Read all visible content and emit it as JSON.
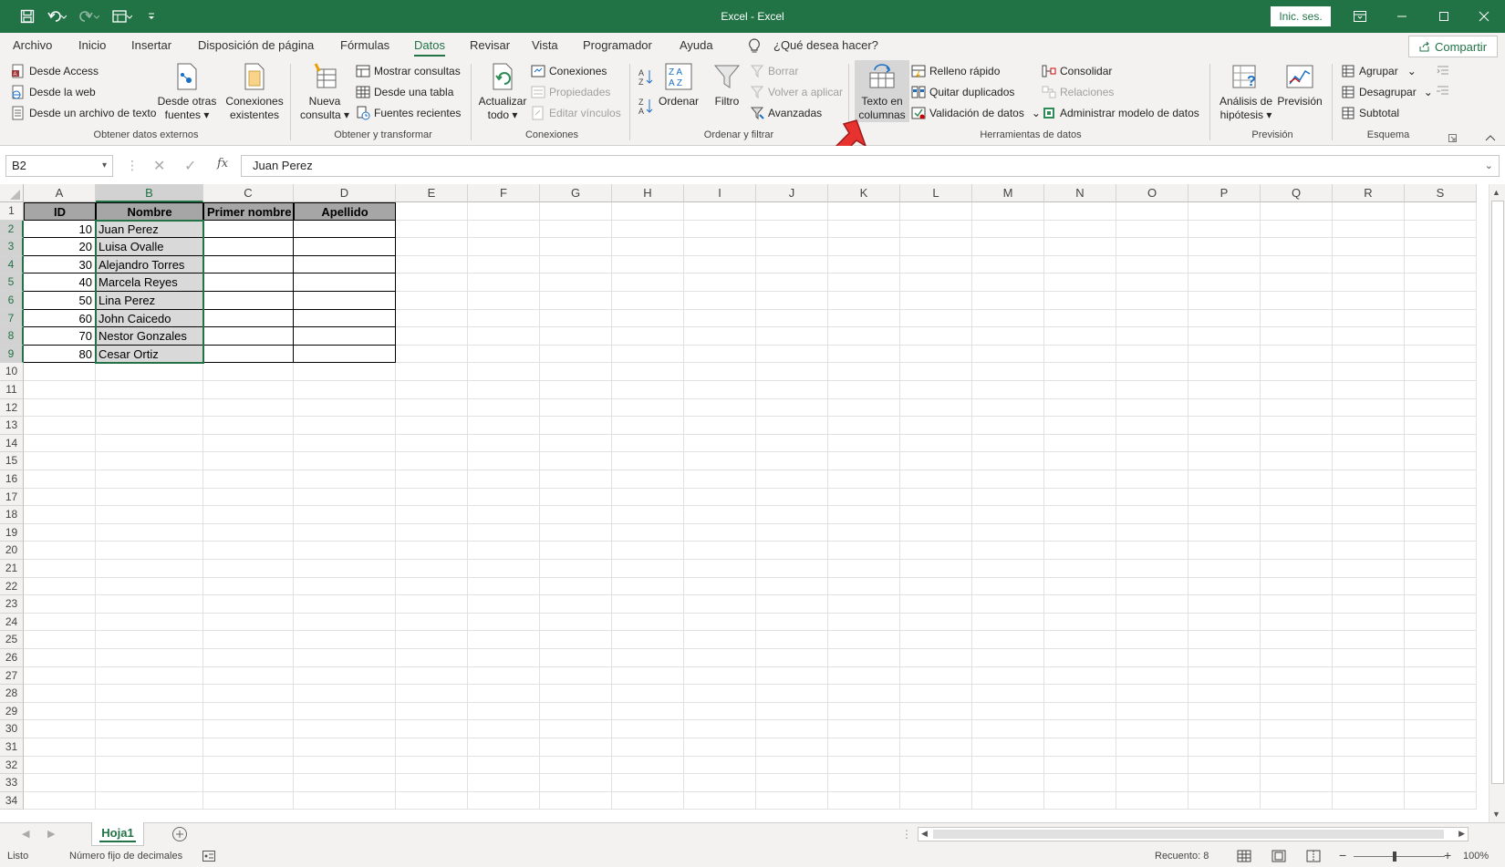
{
  "window": {
    "title": "Excel - Excel",
    "signin_label": "Inic. ses.",
    "accent_color": "#217346"
  },
  "qat": {
    "icons": [
      "save-icon",
      "undo-icon",
      "redo-icon",
      "form-icon",
      "customize-icon"
    ]
  },
  "tabs": [
    {
      "label": "Archivo"
    },
    {
      "label": "Inicio"
    },
    {
      "label": "Insertar"
    },
    {
      "label": "Disposición de página"
    },
    {
      "label": "Fórmulas"
    },
    {
      "label": "Datos"
    },
    {
      "label": "Revisar"
    },
    {
      "label": "Vista"
    },
    {
      "label": "Programador"
    },
    {
      "label": "Ayuda"
    }
  ],
  "active_tab": "Datos",
  "tell_me": "¿Qué desea hacer?",
  "share_label": "Compartir",
  "ribbon": {
    "obtener": {
      "label": "Obtener datos externos",
      "desde_access": "Desde Access",
      "desde_web": "Desde la web",
      "desde_texto": "Desde un archivo de texto",
      "otras_fuentes_1": "Desde otras",
      "otras_fuentes_2": "fuentes",
      "conexiones_existentes_1": "Conexiones",
      "conexiones_existentes_2": "existentes"
    },
    "transformar": {
      "label": "Obtener y transformar",
      "nueva_1": "Nueva",
      "nueva_2": "consulta",
      "mostrar_consultas": "Mostrar consultas",
      "desde_tabla": "Desde una tabla",
      "fuentes_recientes": "Fuentes recientes"
    },
    "conexiones": {
      "label": "Conexiones",
      "actualizar_1": "Actualizar",
      "actualizar_2": "todo",
      "conexiones": "Conexiones",
      "propiedades": "Propiedades",
      "editar_vinculos": "Editar vínculos"
    },
    "ordenar": {
      "label": "Ordenar y filtrar",
      "ordenar": "Ordenar",
      "filtro": "Filtro",
      "borrar": "Borrar",
      "volver": "Volver a aplicar",
      "avanzadas": "Avanzadas"
    },
    "herramientas": {
      "label": "Herramientas de datos",
      "texto_columnas_1": "Texto en",
      "texto_columnas_2": "columnas",
      "relleno": "Relleno rápido",
      "quitar_dup": "Quitar duplicados",
      "validacion": "Validación de datos",
      "consolidar": "Consolidar",
      "relaciones": "Relaciones",
      "modelo": "Administrar modelo de datos"
    },
    "prevision": {
      "label": "Previsión",
      "analisis_1": "Análisis de",
      "analisis_2": "hipótesis",
      "prevision": "Previsión"
    },
    "esquema": {
      "label": "Esquema",
      "agrupar": "Agrupar",
      "desagrupar": "Desagrupar",
      "subtotal": "Subtotal"
    }
  },
  "formula_bar": {
    "name_box": "B2",
    "fx_label": "fx",
    "content": "Juan Perez"
  },
  "columns": [
    "A",
    "B",
    "C",
    "D",
    "E",
    "F",
    "G",
    "H",
    "I",
    "J",
    "K",
    "L",
    "M",
    "N",
    "O",
    "P",
    "Q",
    "R",
    "S"
  ],
  "rows": [
    "1",
    "2",
    "3",
    "4",
    "5",
    "6",
    "7",
    "8",
    "9",
    "10",
    "11",
    "12",
    "13",
    "14",
    "15",
    "16",
    "17",
    "18",
    "19",
    "20",
    "21",
    "22",
    "23",
    "24",
    "25",
    "26",
    "27",
    "28",
    "29",
    "30",
    "31",
    "32",
    "33",
    "34"
  ],
  "table": {
    "headers": [
      "ID",
      "Nombre",
      "Primer nombre",
      "Apellido"
    ],
    "data": [
      {
        "id": "10",
        "nombre": "Juan Perez"
      },
      {
        "id": "20",
        "nombre": "Luisa Ovalle"
      },
      {
        "id": "30",
        "nombre": "Alejandro Torres"
      },
      {
        "id": "40",
        "nombre": "Marcela Reyes"
      },
      {
        "id": "50",
        "nombre": "Lina Perez"
      },
      {
        "id": "60",
        "nombre": "John Caicedo"
      },
      {
        "id": "70",
        "nombre": "Nestor Gonzales"
      },
      {
        "id": "80",
        "nombre": "Cesar Ortiz"
      }
    ]
  },
  "sheet_tab": "Hoja1",
  "status": {
    "ready": "Listo",
    "fixed_decimal": "Número fijo de decimales",
    "count": "Recuento: 8",
    "zoom": "100%"
  }
}
